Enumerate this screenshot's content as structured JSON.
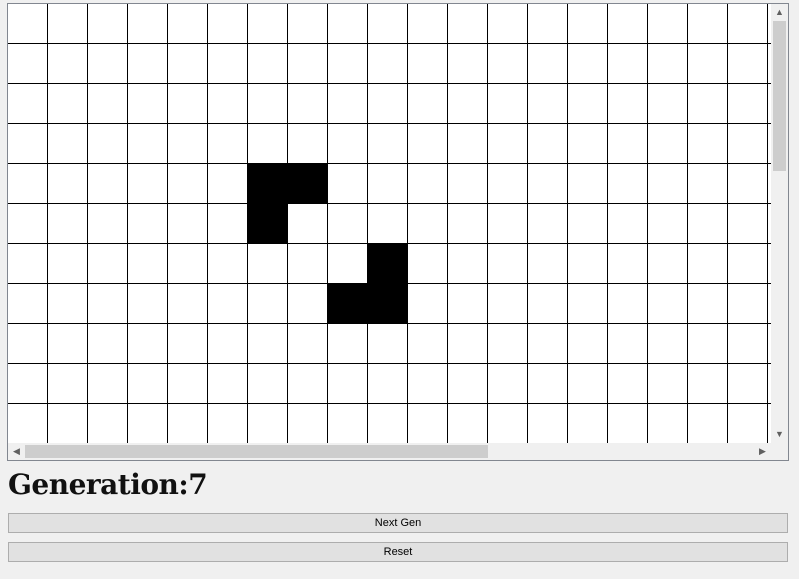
{
  "grid": {
    "columns": 20,
    "rows": 11,
    "alive_cells": [
      [
        4,
        6
      ],
      [
        4,
        7
      ],
      [
        5,
        6
      ],
      [
        6,
        9
      ],
      [
        7,
        8
      ],
      [
        7,
        9
      ]
    ],
    "alive_color": "#000000",
    "dead_color": "#ffffff"
  },
  "scrollbars": {
    "up_icon": "▲",
    "down_icon": "▼",
    "left_icon": "◀",
    "right_icon": "▶"
  },
  "status": {
    "generation_label": "Generation:7"
  },
  "buttons": {
    "next_gen_label": "Next Gen",
    "reset_label": "Reset"
  }
}
